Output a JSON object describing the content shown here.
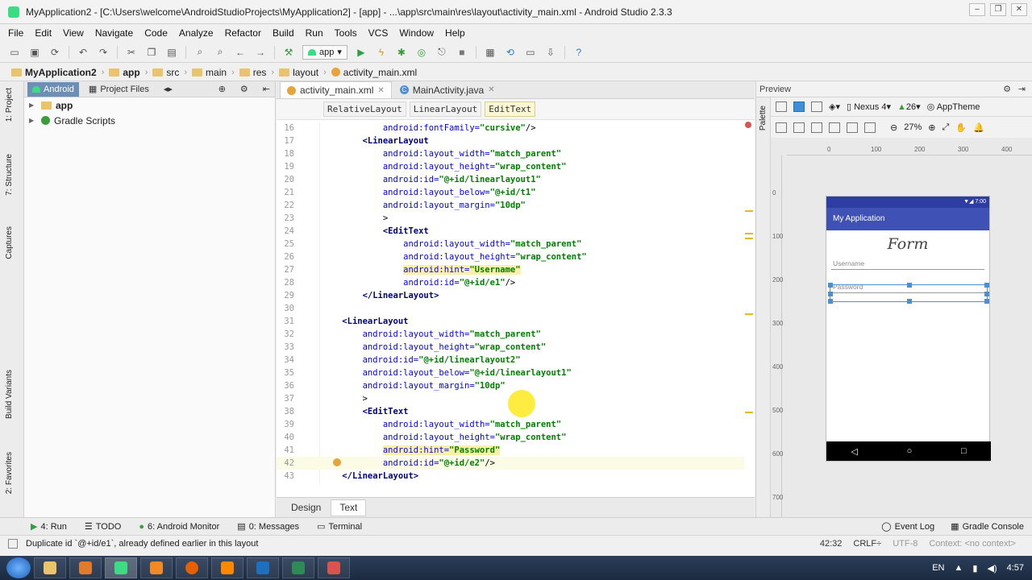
{
  "window": {
    "title": "MyApplication2 - [C:\\Users\\welcome\\AndroidStudioProjects\\MyApplication2] - [app] - ...\\app\\src\\main\\res\\layout\\activity_main.xml - Android Studio 2.3.3"
  },
  "menu": [
    "File",
    "Edit",
    "View",
    "Navigate",
    "Code",
    "Analyze",
    "Refactor",
    "Build",
    "Run",
    "Tools",
    "VCS",
    "Window",
    "Help"
  ],
  "toolbar": {
    "run_config": "app"
  },
  "breadcrumb": [
    "MyApplication2",
    "app",
    "src",
    "main",
    "res",
    "layout",
    "activity_main.xml"
  ],
  "left_tabs": [
    "1: Project",
    "7: Structure",
    "Captures",
    "Build Variants",
    "2: Favorites"
  ],
  "project_panel": {
    "tabs": [
      "Android",
      "Project Files"
    ],
    "tree": [
      "app",
      "Gradle Scripts"
    ]
  },
  "editor": {
    "tabs": [
      {
        "label": "activity_main.xml"
      },
      {
        "label": "MainActivity.java"
      }
    ],
    "xml_breadcrumb": [
      "RelativeLayout",
      "LinearLayout",
      "EditText"
    ],
    "bottom_tabs": [
      "Design",
      "Text"
    ],
    "lines": [
      {
        "n": "16",
        "indent": "            ",
        "parts": [
          {
            "t": "android:fontFamily=",
            "c": "attr"
          },
          {
            "t": "\"cursive\"",
            "c": "val"
          },
          {
            "t": "/>",
            "c": "p"
          }
        ]
      },
      {
        "n": "17",
        "indent": "        ",
        "parts": [
          {
            "t": "<LinearLayout",
            "c": "tag"
          }
        ]
      },
      {
        "n": "18",
        "indent": "            ",
        "parts": [
          {
            "t": "android:layout_width=",
            "c": "attr"
          },
          {
            "t": "\"match_parent\"",
            "c": "val"
          }
        ]
      },
      {
        "n": "19",
        "indent": "            ",
        "parts": [
          {
            "t": "android:layout_height=",
            "c": "attr"
          },
          {
            "t": "\"wrap_content\"",
            "c": "val"
          }
        ]
      },
      {
        "n": "20",
        "indent": "            ",
        "parts": [
          {
            "t": "android:id=",
            "c": "attr"
          },
          {
            "t": "\"@+id/linearlayout1\"",
            "c": "val"
          }
        ]
      },
      {
        "n": "21",
        "indent": "            ",
        "parts": [
          {
            "t": "android:layout_below=",
            "c": "attr"
          },
          {
            "t": "\"@+id/t1\"",
            "c": "val"
          }
        ]
      },
      {
        "n": "22",
        "indent": "            ",
        "parts": [
          {
            "t": "android:layout_margin=",
            "c": "attr"
          },
          {
            "t": "\"10dp\"",
            "c": "val"
          }
        ]
      },
      {
        "n": "23",
        "indent": "            ",
        "parts": [
          {
            "t": ">",
            "c": "p"
          }
        ]
      },
      {
        "n": "24",
        "indent": "            ",
        "parts": [
          {
            "t": "<EditText",
            "c": "tag"
          }
        ]
      },
      {
        "n": "25",
        "indent": "                ",
        "parts": [
          {
            "t": "android:layout_width=",
            "c": "attr"
          },
          {
            "t": "\"match_parent\"",
            "c": "val"
          }
        ]
      },
      {
        "n": "26",
        "indent": "                ",
        "parts": [
          {
            "t": "android:layout_height=",
            "c": "attr"
          },
          {
            "t": "\"wrap_content\"",
            "c": "val"
          }
        ]
      },
      {
        "n": "27",
        "indent": "                ",
        "parts": [
          {
            "t": "android:hint=",
            "c": "attr hl"
          },
          {
            "t": "\"Username\"",
            "c": "val hl"
          }
        ]
      },
      {
        "n": "28",
        "indent": "                ",
        "parts": [
          {
            "t": "android:id=",
            "c": "attr"
          },
          {
            "t": "\"@+id/e1\"",
            "c": "val"
          },
          {
            "t": "/>",
            "c": "p"
          }
        ]
      },
      {
        "n": "29",
        "indent": "        ",
        "parts": [
          {
            "t": "</LinearLayout>",
            "c": "tag"
          }
        ]
      },
      {
        "n": "30",
        "indent": "",
        "parts": []
      },
      {
        "n": "31",
        "indent": "    ",
        "parts": [
          {
            "t": "<LinearLayout",
            "c": "tag"
          }
        ]
      },
      {
        "n": "32",
        "indent": "        ",
        "parts": [
          {
            "t": "android:layout_width=",
            "c": "attr"
          },
          {
            "t": "\"match_parent\"",
            "c": "val"
          }
        ]
      },
      {
        "n": "33",
        "indent": "        ",
        "parts": [
          {
            "t": "android:layout_height=",
            "c": "attr"
          },
          {
            "t": "\"wrap_content\"",
            "c": "val"
          }
        ]
      },
      {
        "n": "34",
        "indent": "        ",
        "parts": [
          {
            "t": "android:id=",
            "c": "attr"
          },
          {
            "t": "\"@+id/linearlayout2\"",
            "c": "val"
          }
        ]
      },
      {
        "n": "35",
        "indent": "        ",
        "parts": [
          {
            "t": "android:layout_below=",
            "c": "attr"
          },
          {
            "t": "\"@+id/linearlayout1\"",
            "c": "val"
          }
        ]
      },
      {
        "n": "36",
        "indent": "        ",
        "parts": [
          {
            "t": "android:layout_margin=",
            "c": "attr"
          },
          {
            "t": "\"10dp\"",
            "c": "val"
          }
        ]
      },
      {
        "n": "37",
        "indent": "        ",
        "parts": [
          {
            "t": ">",
            "c": "p"
          }
        ]
      },
      {
        "n": "38",
        "indent": "        ",
        "parts": [
          {
            "t": "<EditText",
            "c": "tag"
          }
        ]
      },
      {
        "n": "39",
        "indent": "            ",
        "parts": [
          {
            "t": "android:layout_width=",
            "c": "attr"
          },
          {
            "t": "\"match_parent\"",
            "c": "val"
          }
        ]
      },
      {
        "n": "40",
        "indent": "            ",
        "parts": [
          {
            "t": "android:layout_height=",
            "c": "attr"
          },
          {
            "t": "\"wrap_content\"",
            "c": "val"
          }
        ]
      },
      {
        "n": "41",
        "indent": "            ",
        "parts": [
          {
            "t": "android:hint=",
            "c": "attr hl"
          },
          {
            "t": "\"Password\"",
            "c": "val hl"
          }
        ]
      },
      {
        "n": "42",
        "indent": "            ",
        "parts": [
          {
            "t": "android:id=",
            "c": "attr"
          },
          {
            "t": "\"@+id/e2\"",
            "c": "val"
          },
          {
            "t": "/>",
            "c": "p"
          }
        ],
        "current": true
      },
      {
        "n": "43",
        "indent": "    ",
        "parts": [
          {
            "t": "</LinearLayout>",
            "c": "tag"
          }
        ]
      },
      {
        "n": "44",
        "indent": "",
        "parts": []
      }
    ]
  },
  "preview": {
    "title": "Preview",
    "palette_label": "Palette",
    "device": "Nexus 4",
    "api": "26",
    "theme": "AppTheme",
    "zoom": "27%",
    "ruler_top": [
      "0",
      "100",
      "200",
      "300",
      "400"
    ],
    "ruler_left": [
      "0",
      "100",
      "200",
      "300",
      "400",
      "500",
      "600",
      "700"
    ],
    "phone": {
      "time": "7:00",
      "app_title": "My Application",
      "form_title": "Form",
      "username_hint": "Username",
      "password_hint": "Password",
      "nav": [
        "◁",
        "○",
        "□"
      ]
    }
  },
  "bottom_tools": {
    "left": [
      "4: Run",
      "TODO",
      "6: Android Monitor",
      "0: Messages",
      "Terminal"
    ],
    "right": [
      "Event Log",
      "Gradle Console"
    ]
  },
  "status": {
    "message": "Duplicate id `@+id/e1`, already defined earlier in this layout",
    "position": "42:32",
    "line_sep": "CRLF÷",
    "encoding": "UTF-8",
    "context": "Context: <no context>"
  },
  "taskbar": {
    "lang": "EN",
    "time": "4:57"
  },
  "colors": {
    "app_bar": "#3f51b5",
    "status_bar": "#2d3da3",
    "selection": "#4c8fd6"
  }
}
